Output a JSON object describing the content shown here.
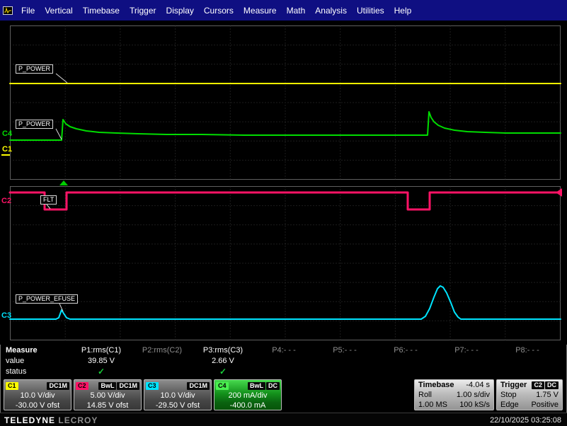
{
  "menu": {
    "items": [
      "File",
      "Vertical",
      "Timebase",
      "Trigger",
      "Display",
      "Cursors",
      "Measure",
      "Math",
      "Analysis",
      "Utilities",
      "Help"
    ]
  },
  "scope": {
    "labels": {
      "c1_trace": "P_POWER",
      "c4_trace": "P_POWER",
      "c2_trace": "FLT",
      "c3_trace": "P_POWER_EFUSE"
    },
    "channel_markers": {
      "c1": "C1",
      "c2": "C2",
      "c3": "C3",
      "c4": "C4"
    },
    "colors": {
      "c1": "#ffff00",
      "c2": "#ff1366",
      "c3": "#00e4ff",
      "c4": "#00dc00",
      "trigger_time_marker": "#00cc00",
      "trigger_level_marker": "#ff1366"
    },
    "traces": {
      "c1_points": [
        [
          14,
          89
        ],
        [
          792,
          89
        ]
      ],
      "c4_points": [
        [
          14,
          169
        ],
        [
          87,
          169
        ],
        [
          89,
          140
        ],
        [
          93,
          146
        ],
        [
          99,
          150
        ],
        [
          108,
          153
        ],
        [
          122,
          156
        ],
        [
          140,
          158
        ],
        [
          165,
          159
        ],
        [
          195,
          160
        ],
        [
          235,
          161
        ],
        [
          285,
          161
        ],
        [
          345,
          162
        ],
        [
          420,
          162
        ],
        [
          500,
          162
        ],
        [
          570,
          162
        ],
        [
          604,
          162
        ],
        [
          606,
          129
        ],
        [
          609,
          137
        ],
        [
          613,
          143
        ],
        [
          619,
          148
        ],
        [
          628,
          152
        ],
        [
          642,
          155
        ],
        [
          660,
          157
        ],
        [
          685,
          158
        ],
        [
          715,
          159
        ],
        [
          755,
          159
        ],
        [
          792,
          159
        ]
      ],
      "c2_points": [
        [
          14,
          243
        ],
        [
          63,
          243
        ],
        [
          63,
          267
        ],
        [
          94,
          267
        ],
        [
          94,
          243
        ],
        [
          576,
          243
        ],
        [
          576,
          267
        ],
        [
          607,
          267
        ],
        [
          607,
          243
        ],
        [
          792,
          243
        ]
      ],
      "c3_points": [
        [
          14,
          422
        ],
        [
          79,
          422
        ],
        [
          83,
          420
        ],
        [
          87,
          409
        ],
        [
          90,
          414
        ],
        [
          94,
          420
        ],
        [
          99,
          422
        ],
        [
          595,
          422
        ],
        [
          601,
          418
        ],
        [
          607,
          407
        ],
        [
          613,
          391
        ],
        [
          618,
          379
        ],
        [
          622,
          375
        ],
        [
          626,
          377
        ],
        [
          631,
          385
        ],
        [
          637,
          399
        ],
        [
          642,
          412
        ],
        [
          647,
          419
        ],
        [
          651,
          422
        ],
        [
          792,
          422
        ]
      ]
    }
  },
  "measure": {
    "row_labels": {
      "name": "Measure",
      "value": "value",
      "status": "status"
    },
    "columns": [
      {
        "header": "P1:rms(C1)",
        "value": "39.85 V",
        "status": "✓"
      },
      {
        "header": "P2:rms(C2)",
        "value": "",
        "status": ""
      },
      {
        "header": "P3:rms(C3)",
        "value": "2.66 V",
        "status": "✓"
      },
      {
        "header": "P4:- - -",
        "value": "",
        "status": ""
      },
      {
        "header": "P5:- - -",
        "value": "",
        "status": ""
      },
      {
        "header": "P6:- - -",
        "value": "",
        "status": ""
      },
      {
        "header": "P7:- - -",
        "value": "",
        "status": ""
      },
      {
        "header": "P8:- - -",
        "value": "",
        "status": ""
      }
    ]
  },
  "descriptors": {
    "c1": {
      "label": "C1",
      "coupling": "DC1M",
      "scale": "10.0 V/div",
      "offset": "-30.00 V ofst"
    },
    "c2": {
      "label": "C2",
      "bwl": "BwL",
      "coupling": "DC1M",
      "scale": "5.00 V/div",
      "offset": "14.85 V ofst"
    },
    "c3": {
      "label": "C3",
      "coupling": "DC1M",
      "scale": "10.0 V/div",
      "offset": "-29.50 V ofst"
    },
    "c4": {
      "label": "C4",
      "bwl": "BwL",
      "coupling": "DC",
      "scale": "200 mA/div",
      "offset": "-400.0 mA"
    }
  },
  "timebase": {
    "title": "Timebase",
    "delay": "-4.04 s",
    "mode": "Roll",
    "scale": "1.00 s/div",
    "samples": "1.00 MS",
    "rate": "100 kS/s"
  },
  "trigger": {
    "title": "Trigger",
    "source": "C2",
    "coupling": "DC",
    "mode": "Stop",
    "level": "1.75 V",
    "type": "Edge",
    "slope": "Positive"
  },
  "footer": {
    "brand1": "TELEDYNE",
    "brand2": "LECROY",
    "timestamp": "22/10/2025 03:25:08"
  }
}
